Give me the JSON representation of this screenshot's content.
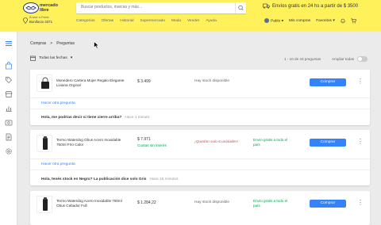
{
  "header": {
    "logo_line1": "mercado",
    "logo_line2": "libre",
    "search_placeholder": "Buscar productos, marcas y más…",
    "promo": "Envíos gratis en 24 hs a partir de $ 3500",
    "location_line1": "Enviar a Pablo",
    "location_line2": "Bonifacio 3371",
    "nav": [
      "Categorías",
      "Ofertas",
      "Historial",
      "Supermercado",
      "Moda",
      "Vender",
      "Ayuda"
    ],
    "user": "Pablo",
    "my_purchases": "Mis compras",
    "favorites": "Favoritos",
    "colors": {
      "brand_yellow": "#fff159",
      "accent_blue": "#3483fa",
      "green": "#00a650",
      "warning_red": "#f23d4f"
    }
  },
  "breadcrumb": {
    "parent": "Compras",
    "separator": ">",
    "current": "Preguntas"
  },
  "toolbar": {
    "filter": "Todas las fechas",
    "pager": "1 - 10 de 43 preguntas",
    "expand_label": "Ampliar todas"
  },
  "cards": [
    {
      "title": "Monedero Cartera Mujer Regalo Elegante Liviana Orginal",
      "price": "$ 3.499",
      "cuotas": "",
      "stock": "Hay stock disponible",
      "shipping": "",
      "buy": "Comprar",
      "ask": "Hacer otra pregunta",
      "question": "Hola, me podrías decir si tiene cierre arriba?",
      "ago": "Hace 1 minuto"
    },
    {
      "title": "Termo Waterdog Obus Acero Inoxidable 750ml Frío Calor",
      "price": "$ 7.971",
      "cuotas": "Cuotas sin interés",
      "stock": "¡Quedan solo 6 unidades!",
      "shipping": "Envío gratis a todo el país",
      "buy": "Comprar",
      "ask": "Hacer otra pregunta",
      "question": "Hola, tenés stock en Negro? La publicación dice solo Gris",
      "ago": "Hace 16 minutos"
    },
    {
      "title": "Termo Waterdog Acero Inoxidable 750ml Obus Cebador Full",
      "price": "$ 1.284,22",
      "cuotas": "",
      "stock": "Hay stock disponible",
      "shipping": "Envío gratis a todo el país",
      "buy": "Comprar"
    }
  ],
  "icons": {
    "sidebar": [
      "menu-icon",
      "bag-icon",
      "tag-icon",
      "store-icon",
      "chart-icon",
      "billing-icon",
      "document-icon",
      "settings-icon"
    ]
  }
}
